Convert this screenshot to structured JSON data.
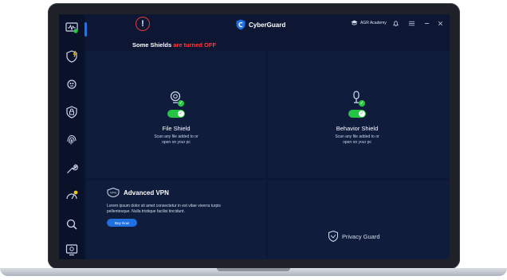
{
  "app": {
    "name": "CyberGuard",
    "academy_label": "AGR Academy",
    "alert_glyph": "!"
  },
  "status": {
    "prefix": "Some Shields",
    "suffix": "are turned OFF"
  },
  "shields": {
    "file": {
      "title": "File Shield",
      "desc_line1": "Scan any file added to or",
      "desc_line2": "open on your pc",
      "enabled": true
    },
    "behavior": {
      "title": "Behavior Shield",
      "desc_line1": "Scan any file added to or",
      "desc_line2": "open on your pc",
      "enabled": true
    }
  },
  "vpn": {
    "title": "Advanced VPN",
    "desc_line1": "Lorem ipsum dolor sit amet consectetur in est vitae viverra turpis",
    "desc_line2": "pellentesque. Nulla tristique facilisi tincidunt.",
    "button": "Buy Now"
  },
  "privacy": {
    "label": "Privacy Guard"
  },
  "sidebar": {
    "items": [
      "monitor-icon",
      "shield-bolt-icon",
      "virus-icon",
      "shield-lock-icon",
      "fingerprint-icon",
      "wrench-icon",
      "speedometer-icon",
      "search-icon",
      "settings-monitor-icon"
    ]
  },
  "colors": {
    "background": "#0d1733",
    "sidebar": "#0a1229",
    "accent": "#1f6fe0",
    "alert": "#ff3b3b",
    "toggle_on": "#25c443"
  }
}
